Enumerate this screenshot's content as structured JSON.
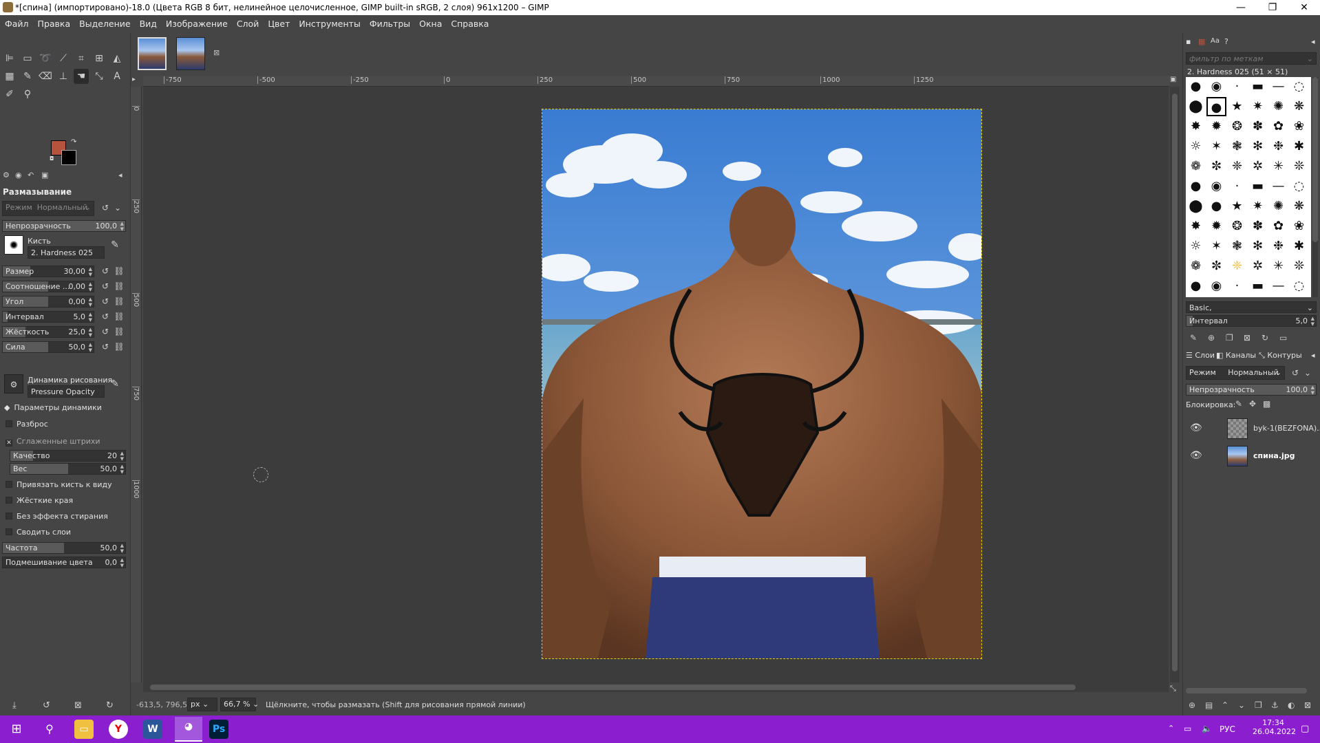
{
  "window": {
    "title": "*[спина] (импортировано)-18.0 (Цвета RGB 8 бит, нелинейное целочисленное, GIMP built-in sRGB, 2 слоя) 961x1200 – GIMP",
    "minimize": "—",
    "maximize": "❐",
    "close": "✕"
  },
  "menu": [
    "Файл",
    "Правка",
    "Выделение",
    "Вид",
    "Изображение",
    "Слой",
    "Цвет",
    "Инструменты",
    "Фильтры",
    "Окна",
    "Справка"
  ],
  "tool_options": {
    "title": "Размазывание",
    "mode_label": "Режим",
    "mode_value": "Нормальный",
    "opacity": {
      "label": "Непрозрачность",
      "value": "100,0"
    },
    "brush_label": "Кисть",
    "brush_value": "2. Hardness 025",
    "sliders": [
      {
        "label": "Размер",
        "value": "30,00",
        "fill": 0.3
      },
      {
        "label": "Соотношение ...",
        "value": "0,00",
        "fill": 0.5
      },
      {
        "label": "Угол",
        "value": "0,00",
        "fill": 0.5
      },
      {
        "label": "Интервал",
        "value": "5,0",
        "fill": 0.05
      },
      {
        "label": "Жёсткость",
        "value": "25,0",
        "fill": 0.25
      },
      {
        "label": "Сила",
        "value": "50,0",
        "fill": 0.5
      }
    ],
    "dynamics_label": "Динамика рисования",
    "dynamics_value": "Pressure Opacity",
    "dynamics_params": "Параметры динамики",
    "scatter": "Разброс",
    "smooth": "Сглаженные штрихи",
    "quality": {
      "label": "Качество",
      "value": "20"
    },
    "weight": {
      "label": "Вес",
      "value": "50,0"
    },
    "checks": [
      "Привязать кисть к виду",
      "Жёсткие края",
      "Без эффекта стирания",
      "Сводить слои"
    ],
    "rate": {
      "label": "Частота",
      "value": "50,0",
      "fill": 0.5
    },
    "color_mix": {
      "label": "Подмешивание цвета",
      "value": "0,0",
      "fill": 0.0
    }
  },
  "ruler_h": [
    "-750",
    "-500",
    "-250",
    "0",
    "250",
    "500",
    "750",
    "1000",
    "1250"
  ],
  "ruler_v": [
    "0",
    "250",
    "500",
    "750",
    "1000"
  ],
  "status": {
    "coords": "-613,5, 796,5",
    "unit": "px",
    "zoom": "66,7 %",
    "message": "Щёлкните, чтобы размазать (Shift для рисования прямой линии)"
  },
  "brushes": {
    "filter_placeholder": "фильтр по меткам",
    "selected": "2. Hardness 025 (51 × 51)",
    "preset": "Basic,",
    "spacing": {
      "label": "Интервал",
      "value": "5,0"
    }
  },
  "layers": {
    "tabs": [
      "Слои",
      "Каналы",
      "Контуры"
    ],
    "mode_label": "Режим",
    "mode_value": "Нормальный",
    "opacity": {
      "label": "Непрозрачность",
      "value": "100,0"
    },
    "lock_label": "Блокировка:",
    "items": [
      {
        "name": "byk-1(BEZFONA)..."
      },
      {
        "name": "спина.jpg"
      }
    ]
  },
  "taskbar": {
    "lang": "РУС",
    "time": "17:34",
    "date": "26.04.2022"
  }
}
